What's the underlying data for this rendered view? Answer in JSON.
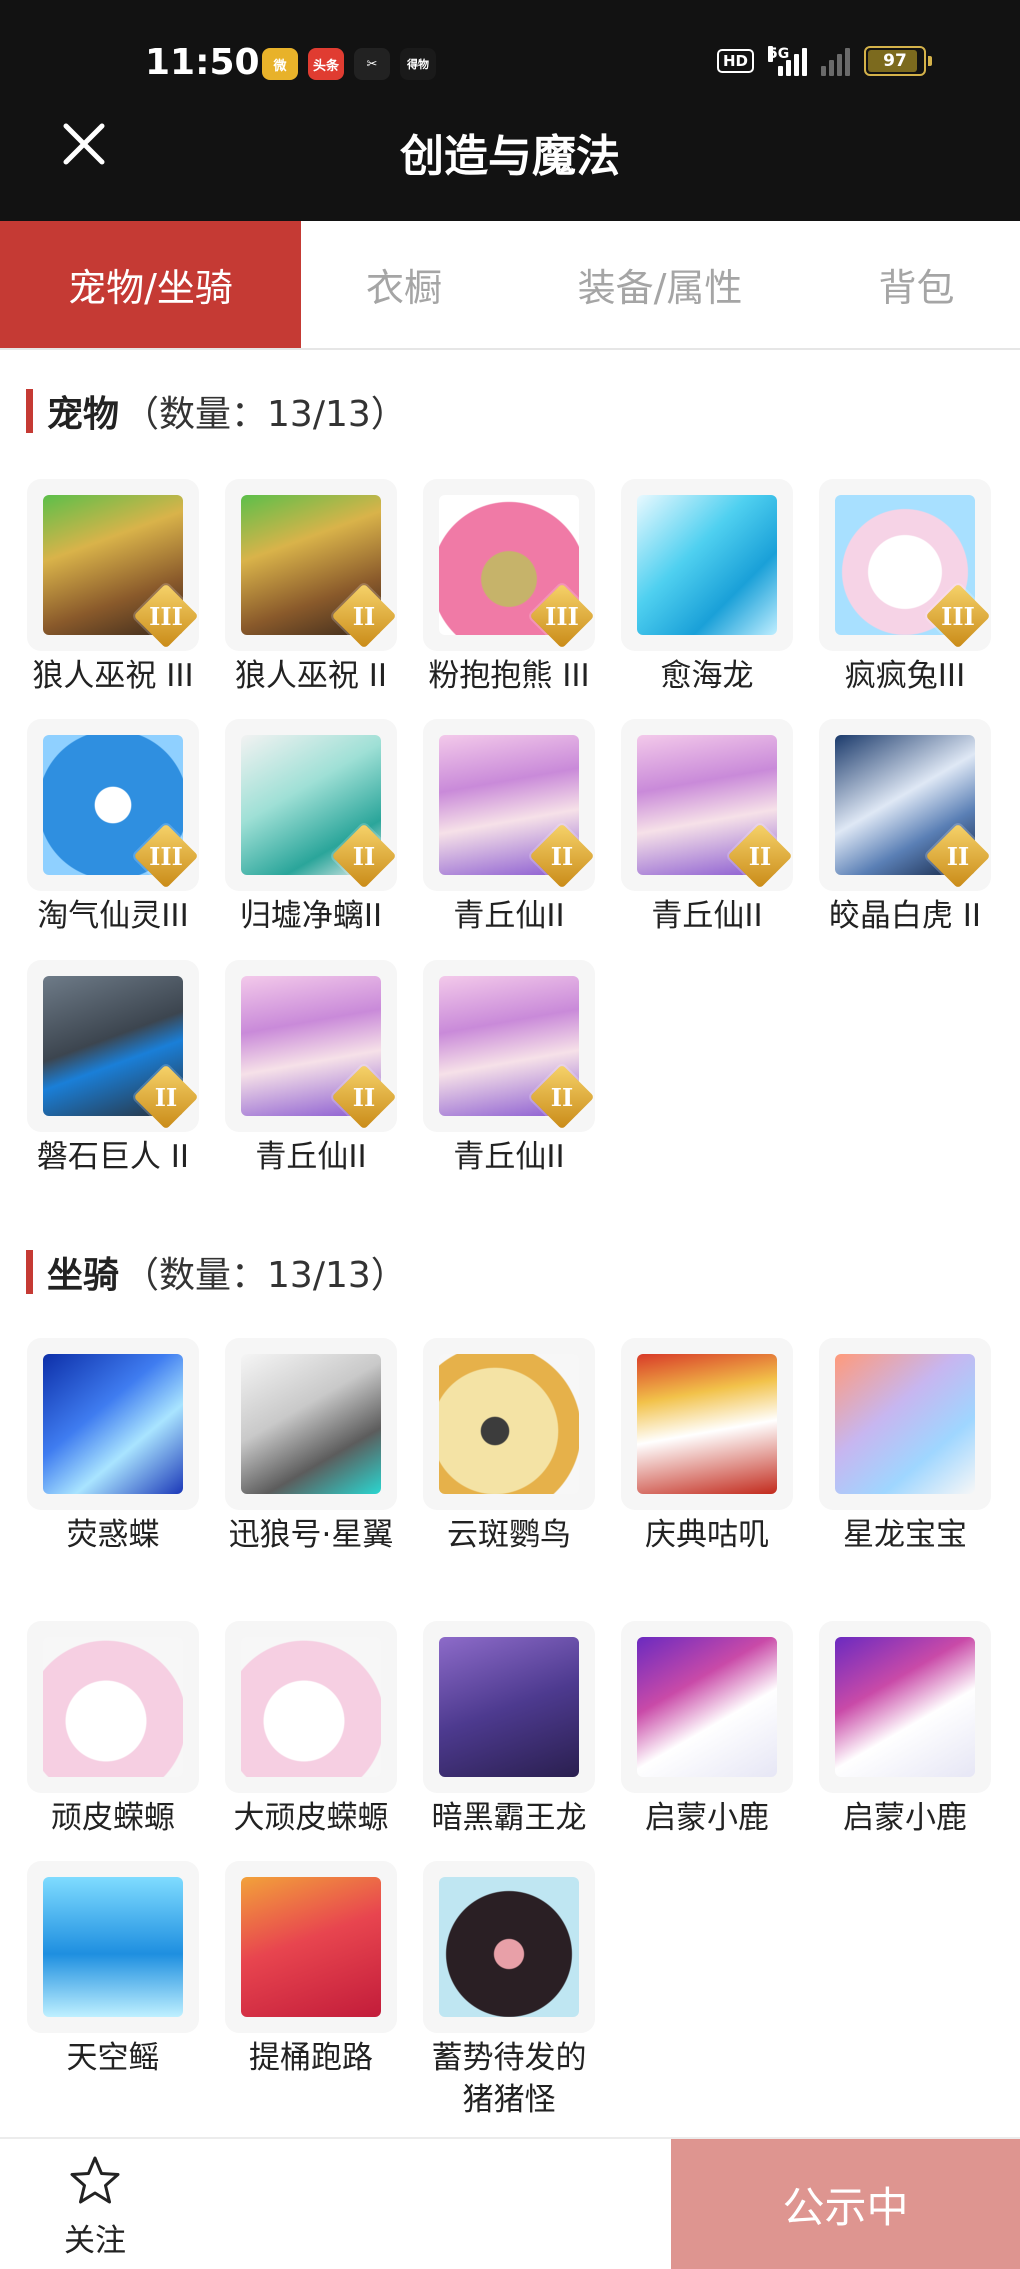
{
  "status_bar": {
    "time": "11:50",
    "apps": [
      {
        "icon": "weibo-icon",
        "text": "微",
        "color": "#e8b22a"
      },
      {
        "icon": "toutiao-icon",
        "text": "头条",
        "color": "#e03c31"
      },
      {
        "icon": "capcut-icon",
        "text": "✂",
        "color": "#222222"
      },
      {
        "icon": "dewu-icon",
        "text": "得物",
        "color": "#1a1a1a"
      }
    ],
    "hd": "HD",
    "network": "5G",
    "battery": "97",
    "battery_level": 0.97
  },
  "header": {
    "title": "创造与魔法",
    "close_icon": "close-icon"
  },
  "tabs": [
    {
      "label": "宠物/坐骑",
      "active": true
    },
    {
      "label": "衣橱",
      "active": false
    },
    {
      "label": "装备/属性",
      "active": false
    },
    {
      "label": "背包",
      "active": false
    }
  ],
  "pets": {
    "title": "宠物",
    "count": "（数量：13/13）",
    "items": [
      {
        "label": "狼人巫祝 III",
        "grade": "III",
        "art": "werewolf"
      },
      {
        "label": "狼人巫祝 II",
        "grade": "II",
        "art": "werewolf"
      },
      {
        "label": "粉抱抱熊 III",
        "grade": "III",
        "art": "pinkbear"
      },
      {
        "label": "愈海龙",
        "grade": "",
        "art": "seadragon"
      },
      {
        "label": "疯疯兔III",
        "grade": "III",
        "art": "rabbit"
      },
      {
        "label": "淘气仙灵III",
        "grade": "III",
        "art": "bluedog"
      },
      {
        "label": "归墟净螭II",
        "grade": "II",
        "art": "tealdragon"
      },
      {
        "label": "青丘仙II",
        "grade": "II",
        "art": "fox"
      },
      {
        "label": "青丘仙II",
        "grade": "II",
        "art": "fox"
      },
      {
        "label": "皎晶白虎 II",
        "grade": "II",
        "art": "tiger"
      },
      {
        "label": "磐石巨人 II",
        "grade": "II",
        "art": "golem"
      },
      {
        "label": "青丘仙II",
        "grade": "II",
        "art": "fox"
      },
      {
        "label": "青丘仙II",
        "grade": "II",
        "art": "fox"
      }
    ]
  },
  "mounts": {
    "title": "坐骑",
    "count": "（数量：13/13）",
    "items": [
      {
        "label": "荧惑蝶",
        "grade": "",
        "art": "butterfly"
      },
      {
        "label": "迅狼号·星翼",
        "grade": "",
        "art": "mechwolf"
      },
      {
        "label": "云斑鹦鸟",
        "grade": "",
        "art": "parrot"
      },
      {
        "label": "庆典咕叽",
        "grade": "",
        "art": "penguin"
      },
      {
        "label": "星龙宝宝",
        "grade": "",
        "art": "stardragon"
      },
      {
        "label": "顽皮蝾螈",
        "grade": "",
        "art": "axolotl"
      },
      {
        "label": "大顽皮蝾螈",
        "grade": "",
        "art": "axolotl"
      },
      {
        "label": "暗黑霸王龙",
        "grade": "",
        "art": "trex"
      },
      {
        "label": "启蒙小鹿",
        "grade": "",
        "art": "deer"
      },
      {
        "label": "启蒙小鹿",
        "grade": "",
        "art": "deer"
      },
      {
        "label": "天空鳐",
        "grade": "",
        "art": "ray"
      },
      {
        "label": "提桶跑路",
        "grade": "",
        "art": "bucket"
      },
      {
        "label": "蓄势待发的猪猪怪",
        "grade": "",
        "art": "pig"
      }
    ]
  },
  "bottom_bar": {
    "follow_label": "关注",
    "follow_icon": "star-icon",
    "publish_label": "公示中"
  }
}
